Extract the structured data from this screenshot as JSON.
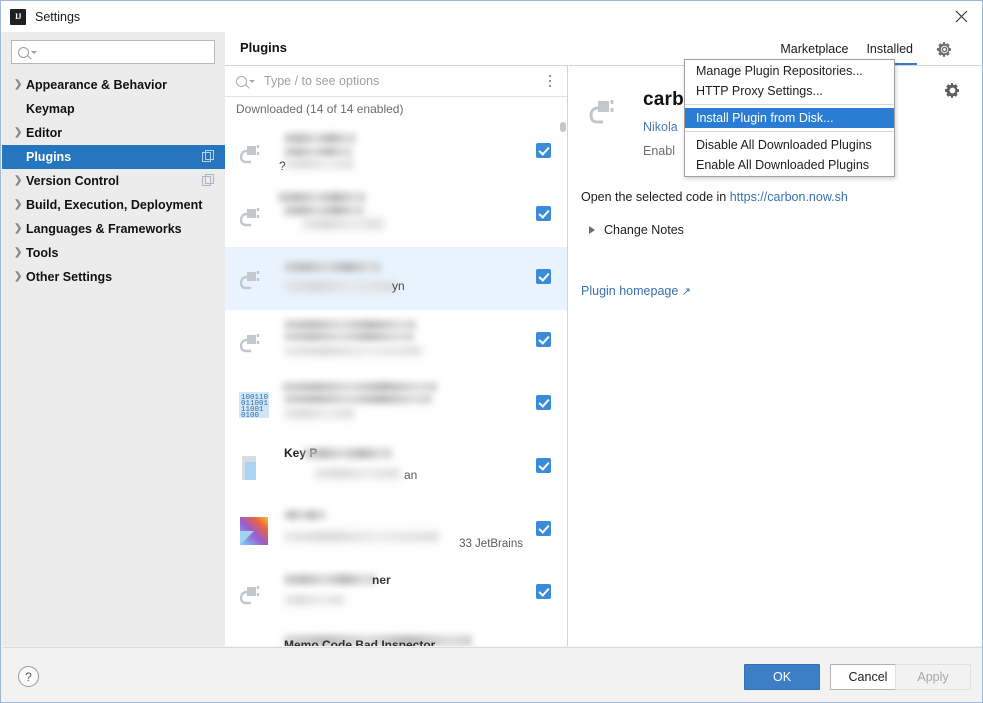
{
  "window": {
    "title": "Settings",
    "app_icon": "IJ",
    "close_icon": "close-icon"
  },
  "sidebar": {
    "search": {
      "value": "",
      "placeholder": ""
    },
    "items": [
      {
        "label": "Appearance & Behavior",
        "expandable": true,
        "selected": false,
        "badge": false
      },
      {
        "label": "Keymap",
        "expandable": false,
        "selected": false,
        "badge": false
      },
      {
        "label": "Editor",
        "expandable": true,
        "selected": false,
        "badge": false
      },
      {
        "label": "Plugins",
        "expandable": false,
        "selected": true,
        "badge": true
      },
      {
        "label": "Version Control",
        "expandable": true,
        "selected": false,
        "badge": true
      },
      {
        "label": "Build, Execution, Deployment",
        "expandable": true,
        "selected": false,
        "badge": false
      },
      {
        "label": "Languages & Frameworks",
        "expandable": true,
        "selected": false,
        "badge": false
      },
      {
        "label": "Tools",
        "expandable": true,
        "selected": false,
        "badge": false
      },
      {
        "label": "Other Settings",
        "expandable": true,
        "selected": false,
        "badge": false
      }
    ]
  },
  "content": {
    "title": "Plugins",
    "tabs": [
      {
        "label": "Marketplace",
        "active": false
      },
      {
        "label": "Installed",
        "active": true
      }
    ],
    "gear_icon": "gear-icon"
  },
  "plugin_list": {
    "search": {
      "value": "",
      "placeholder": "Type / to see options"
    },
    "options_icon": "kebab-menu-icon",
    "group_label": "Downloaded (14 of 14 enabled)",
    "rows": [
      {
        "icon": "plug-icon",
        "name": "",
        "subtitle": "",
        "partial_text": "?",
        "enabled": true,
        "selected": false,
        "meta": ""
      },
      {
        "icon": "plug-icon",
        "name": "",
        "subtitle": "",
        "partial_text": "",
        "enabled": true,
        "selected": false,
        "meta": ""
      },
      {
        "icon": "plug-icon",
        "name": "",
        "subtitle": "",
        "partial_text": "yn",
        "enabled": true,
        "selected": true,
        "meta": ""
      },
      {
        "icon": "plug-icon",
        "name": "",
        "subtitle": "",
        "partial_text": "",
        "enabled": true,
        "selected": false,
        "meta": ""
      },
      {
        "icon": "binary-icon",
        "name": "",
        "subtitle": "",
        "partial_text": "",
        "enabled": true,
        "selected": false,
        "meta": ""
      },
      {
        "icon": "key-icon",
        "name": "Key P",
        "subtitle": "",
        "partial_text": "an",
        "enabled": true,
        "selected": false,
        "meta": ""
      },
      {
        "icon": "kotlin-icon",
        "name": "",
        "subtitle": "",
        "partial_text": "",
        "enabled": true,
        "selected": false,
        "meta": "33  JetBrains"
      },
      {
        "icon": "plug-icon",
        "name": "",
        "subtitle": "",
        "partial_text": "ner",
        "enabled": true,
        "selected": false,
        "meta": ""
      },
      {
        "icon": "plug-icon",
        "name": "Memo Code Bad Inspector",
        "subtitle": "",
        "partial_text": "",
        "enabled": true,
        "selected": false,
        "meta": ""
      }
    ]
  },
  "detail": {
    "icon": "plug-icon",
    "name": "carb",
    "vendor": "Nikola",
    "status": "Enabl",
    "description_prefix": "Open the selected code in ",
    "description_link": "https://carbon.now.sh",
    "change_notes_label": "Change Notes",
    "homepage_label": "Plugin homepage",
    "homepage_arrow": "↗",
    "gear_icon": "gear-icon"
  },
  "popup_menu": {
    "items": [
      {
        "label": "Manage Plugin Repositories...",
        "highlighted": false,
        "separator_after": false
      },
      {
        "label": "HTTP Proxy Settings...",
        "highlighted": false,
        "separator_after": true
      },
      {
        "label": "Install Plugin from Disk...",
        "highlighted": true,
        "separator_after": true
      },
      {
        "label": "Disable All Downloaded Plugins",
        "highlighted": false,
        "separator_after": false
      },
      {
        "label": "Enable All Downloaded Plugins",
        "highlighted": false,
        "separator_after": false
      }
    ]
  },
  "footer": {
    "help_label": "?",
    "ok_label": "OK",
    "cancel_label": "Cancel",
    "apply_label": "Apply"
  },
  "colors": {
    "accent": "#2675bf",
    "tab_underline": "#3a7cc4",
    "checkbox": "#3b8cd8",
    "selected_row": "#e9f3fd",
    "link": "#3b6fb0",
    "menu_highlight": "#2b7cd3"
  }
}
